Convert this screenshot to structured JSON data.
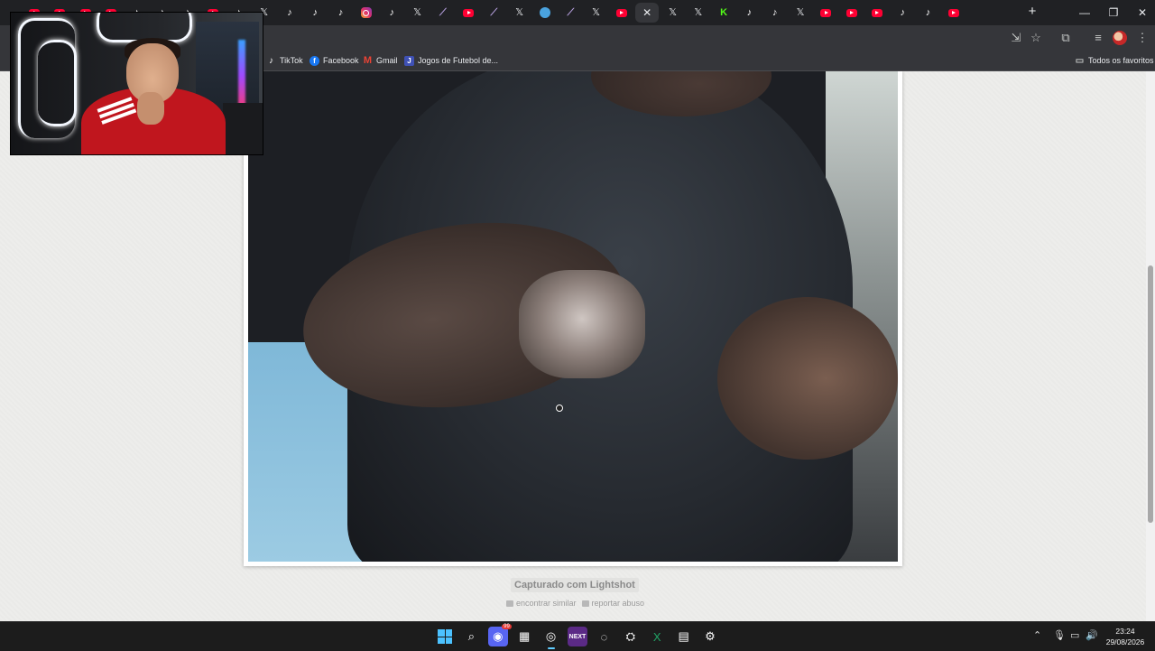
{
  "browser": {
    "tabs": [
      {
        "icon": "youtube-icon"
      },
      {
        "icon": "youtube-icon"
      },
      {
        "icon": "youtube-icon"
      },
      {
        "icon": "youtube-icon"
      },
      {
        "icon": "tiktok-icon"
      },
      {
        "icon": "tiktok-icon"
      },
      {
        "icon": "tiktok-icon"
      },
      {
        "icon": "youtube-icon"
      },
      {
        "icon": "tiktok-icon"
      },
      {
        "icon": "x-icon"
      },
      {
        "icon": "tiktok-icon"
      },
      {
        "icon": "tiktok-icon"
      },
      {
        "icon": "tiktok-icon"
      },
      {
        "icon": "instagram-icon"
      },
      {
        "icon": "tiktok-icon"
      },
      {
        "icon": "x-icon"
      },
      {
        "icon": "feather-icon"
      },
      {
        "icon": "youtube-icon"
      },
      {
        "icon": "feather-icon"
      },
      {
        "icon": "x-icon"
      },
      {
        "icon": "messenger-icon"
      },
      {
        "icon": "feather-icon"
      },
      {
        "icon": "x-icon"
      },
      {
        "icon": "youtube-icon"
      },
      {
        "icon": "close-icon",
        "active": true
      },
      {
        "icon": "x-icon"
      },
      {
        "icon": "x-icon"
      },
      {
        "icon": "kick-icon"
      },
      {
        "icon": "tiktok-icon"
      },
      {
        "icon": "tiktok-icon"
      },
      {
        "icon": "x-icon"
      },
      {
        "icon": "youtube-icon"
      },
      {
        "icon": "youtube-icon"
      },
      {
        "icon": "youtube-icon"
      },
      {
        "icon": "tiktok-icon"
      },
      {
        "icon": "tiktok-icon"
      },
      {
        "icon": "youtube-icon"
      }
    ],
    "new_tab_label": "+",
    "bookmarks": [
      {
        "label": "TikTok",
        "icon": "tiktok-icon"
      },
      {
        "label": "Facebook",
        "icon": "facebook-icon"
      },
      {
        "label": "Gmail",
        "icon": "gmail-icon"
      },
      {
        "label": "Jogos de Futebol de...",
        "icon": "games-icon"
      }
    ],
    "all_bookmarks_label": "Todos os favoritos"
  },
  "page": {
    "captured_label": "Capturado com Lightshot",
    "find_similar_label": "encontrar similar",
    "report_label": "reportar abuso"
  },
  "taskbar": {
    "apps": [
      {
        "name": "start-button",
        "glyph": "win"
      },
      {
        "name": "search-taskbar",
        "glyph": "⌕"
      },
      {
        "name": "discord-app",
        "glyph": "◉",
        "badge": "99"
      },
      {
        "name": "game-app",
        "glyph": "▦"
      },
      {
        "name": "chrome-app",
        "glyph": "◎",
        "active": true
      },
      {
        "name": "next-app",
        "glyph": "NEXT"
      },
      {
        "name": "obs-app",
        "glyph": "◌"
      },
      {
        "name": "steam-app",
        "glyph": "⛭"
      },
      {
        "name": "excel-app",
        "glyph": "X"
      },
      {
        "name": "media-app",
        "glyph": "▤"
      },
      {
        "name": "settings-app",
        "glyph": "⚙"
      }
    ],
    "time": "23:24",
    "date": "29/08/2026"
  }
}
